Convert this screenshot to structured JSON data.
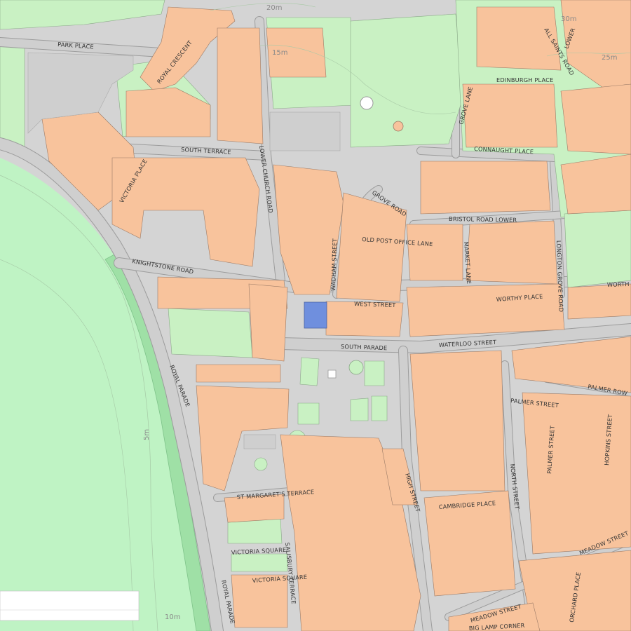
{
  "map": {
    "colors": {
      "sea": "#bff3c4",
      "sea_strip": "#9fe0a6",
      "land_green": "#c9f1c3",
      "building": "#f8c39c",
      "road": "#d4d4d4",
      "highlight": "#6f8fde"
    },
    "street_labels": {
      "park_place": "PARK PLACE",
      "royal_crescent": "ROYAL CRESCENT",
      "south_terrace": "SOUTH TERRACE",
      "lower_church_road": "LOWER CHURCH ROAD",
      "victoria_place": "VICTORIA PLACE",
      "knightstone_road": "KNIGHTSTONE ROAD",
      "royal_parade_1": "ROYAL PARADE",
      "royal_parade_2": "ROYAL PARADE",
      "grove_road": "GROVE ROAD",
      "grove_lane": "GROVE LANE",
      "edinburgh_place": "EDINBURGH PLACE",
      "all_saints_road": "ALL SAINTS ROAD",
      "lower": "LOWER",
      "connaught_place": "CONNAUGHT PLACE",
      "bristol_road_lower": "BRISTOL ROAD LOWER",
      "old_post_office_lane": "OLD POST OFFICE LANE",
      "market_lane": "MARKET LANE",
      "wadham_street": "WADHAM STREET",
      "longton_grove_road": "LONGTON GROVE ROAD",
      "west_street": "WEST STREET",
      "worthy_place": "WORTHY PLACE",
      "worthy_edge": "WORTH",
      "south_parade": "SOUTH PARADE",
      "waterloo_street": "WATERLOO STREET",
      "palmer_row": "PALMER ROW",
      "palmer_street_1": "PALMER STREET",
      "palmer_street_2": "PALMER STREET",
      "hopkins_street": "HOPKINS STREET",
      "high_street": "HIGH STREET",
      "north_street": "NORTH STREET",
      "cambridge_place": "CAMBRIDGE PLACE",
      "st_margarets_terrace": "ST MARGARET'S TERRACE",
      "victoria_square_1": "VICTORIA SQUARE",
      "victoria_square_2": "VICTORIA SQUARE",
      "salisbury_terrace": "SALISBURY TERRACE",
      "meadow_street_1": "MEADOW STREET",
      "meadow_street_2": "MEADOW STREET",
      "orchard_place": "ORCHARD PLACE",
      "big_lamp_corner": "BIG LAMP CORNER"
    },
    "contour_labels": {
      "c20_top": "20m",
      "c15": "15m",
      "c30": "30m",
      "c25": "25m",
      "c5": "5m",
      "c10": "10m"
    }
  }
}
